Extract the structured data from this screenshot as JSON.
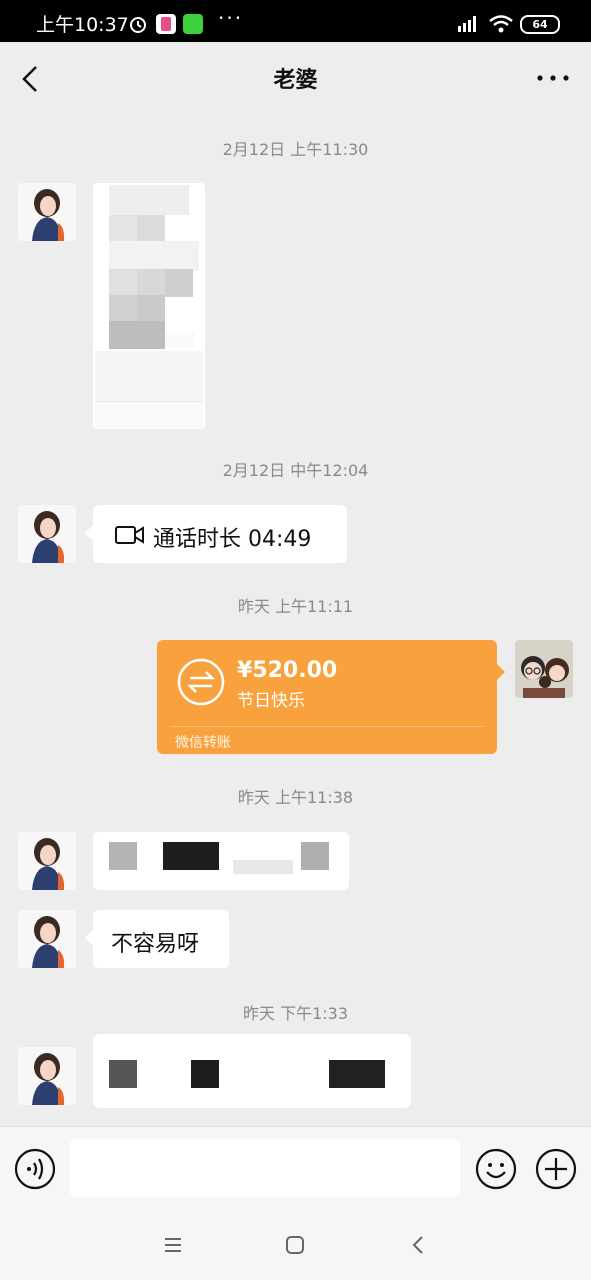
{
  "status": {
    "time": "上午10:37",
    "battery": "64"
  },
  "header": {
    "title": "老婆"
  },
  "messages": {
    "ts1": "2月12日 上午11:30",
    "ts2": "2月12日 中午12:04",
    "call_text": "通话时长 04:49",
    "ts3": "昨天 上午11:11",
    "transfer": {
      "amount": "¥520.00",
      "note": "节日快乐",
      "label": "微信转账"
    },
    "ts4": "昨天 上午11:38",
    "msg_easy": "不容易呀",
    "ts5": "昨天 下午1:33"
  },
  "colors": {
    "accent_transfer": "#f8a13d",
    "background": "#ededed"
  }
}
